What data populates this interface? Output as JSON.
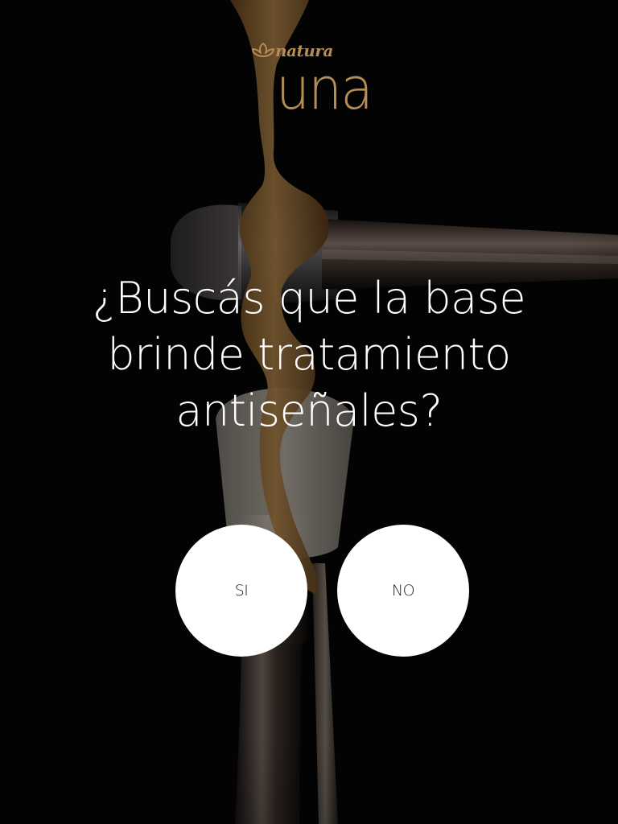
{
  "brand": {
    "name": "natura",
    "line": "una",
    "color": "#b58d55"
  },
  "question": {
    "line1": "¿Buscás que la base",
    "line2": "brinde tratamiento",
    "line3": "antiseñales?"
  },
  "answers": {
    "yes_label": "SI",
    "no_label": "NO"
  }
}
